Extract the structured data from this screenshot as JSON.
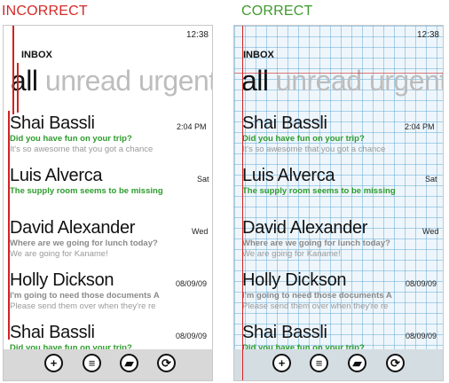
{
  "captions": {
    "incorrect": "INCORRECT",
    "correct": "CORRECT"
  },
  "status_time": "12:38",
  "inbox_label": "INBOX",
  "pivots": [
    "all",
    "unread",
    "urgent"
  ],
  "messages": [
    {
      "sender": "Shai Bassli",
      "date": "2:04 PM",
      "subject": "Did you have fun on your trip?",
      "preview": "It's so awesome that you got a chance",
      "unread": true
    },
    {
      "sender": "Luis Alverca",
      "date": "Sat",
      "subject": "The supply room seems to be missing",
      "preview": "",
      "unread": true
    },
    {
      "sender": "David Alexander",
      "date": "Wed",
      "subject": "Where are we going for lunch today?",
      "preview": "We are going for Kaname!",
      "unread": false
    },
    {
      "sender": "Holly Dickson",
      "date": "08/09/09",
      "subject": "I'm going to need those documents A",
      "preview": "Please send them over when they're re",
      "unread": false
    },
    {
      "sender": "Shai Bassli",
      "date": "08/09/09",
      "subject": "Did you have fun on your trip?",
      "preview": "",
      "unread": true
    }
  ],
  "appbar_icons": [
    "add-icon",
    "list-icon",
    "folder-icon",
    "sync-icon"
  ],
  "colors": {
    "accent_green": "#2d9c2d",
    "guide_red": "#d32222",
    "caption_red": "#d42a2a",
    "caption_green": "#3e9b2c"
  }
}
